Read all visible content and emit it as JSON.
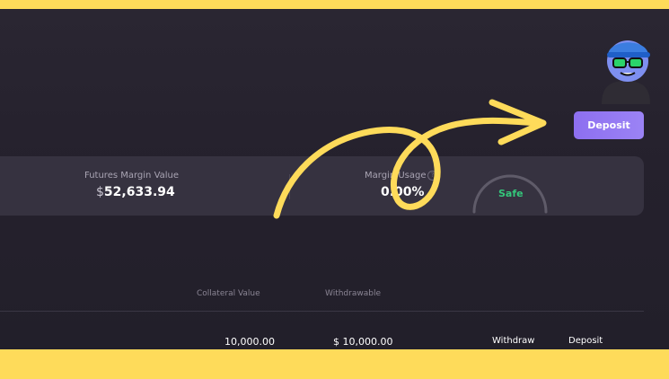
{
  "header": {
    "deposit_label": "Deposit",
    "avatar_icon": "cartoon-avatar-with-sunglasses"
  },
  "summary": {
    "futures_margin_label": "Futures Margin Value",
    "futures_margin_currency": "$",
    "futures_margin_value": "52,633.94",
    "margin_usage_label": "Margin Usage",
    "margin_usage_value": "0.00%",
    "info_icon_glyph": "?",
    "gauge_status": "Safe",
    "gauge_status_color": "#34c77b"
  },
  "table": {
    "headers": {
      "collateral_value": "Collateral Value",
      "withdrawable": "Withdrawable"
    },
    "rows": [
      {
        "collateral_value": "10,000.00",
        "withdrawable_currency": "$",
        "withdrawable": "10,000.00",
        "withdraw_label": "Withdraw",
        "deposit_label": "Deposit"
      }
    ]
  },
  "colors": {
    "frame": "#FEDB5A",
    "background": "#25212d",
    "card": "#363240",
    "accent": "#9b83f5",
    "annotation": "#FEDB5A"
  }
}
